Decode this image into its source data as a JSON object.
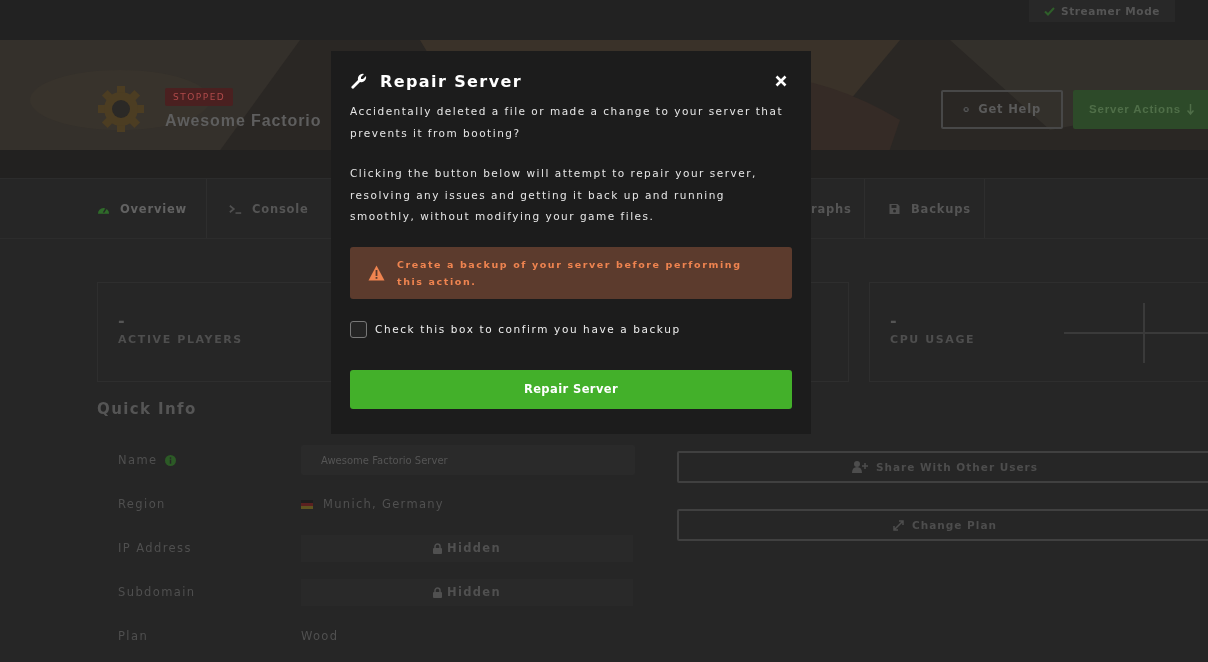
{
  "top_bar": {
    "streamer_mode": {
      "label": "Streamer Mode",
      "checked": true
    }
  },
  "header": {
    "status": "STOPPED",
    "server_name": "Awesome Factorio",
    "buttons": [
      {
        "label": "Get Help",
        "kind": "outline"
      },
      {
        "label": "Server Actions",
        "kind": "primary"
      }
    ]
  },
  "tabs": [
    {
      "label": "Overview",
      "selected": true,
      "kind": "gauge"
    },
    {
      "label": "Console",
      "selected": false,
      "kind": "terminal"
    },
    {
      "label": "raphs",
      "selected": false,
      "kind": "none"
    },
    {
      "label": "Backups",
      "selected": false,
      "kind": "disk"
    }
  ],
  "stats": [
    {
      "kind": "stat",
      "value": "-",
      "label": "ACTIVE PLAYERS"
    },
    {
      "kind": "covered"
    },
    {
      "kind": "stat",
      "value": "-",
      "label": "CPU USAGE"
    }
  ],
  "quick_info": {
    "title": "Quick Info",
    "rows": [
      {
        "label": "Name",
        "kind": "field",
        "value": "Awesome Factorio Server",
        "info": true
      },
      {
        "label": "Region",
        "kind": "flag",
        "value": "Munich, Germany"
      },
      {
        "label": "IP Address",
        "kind": "hidden",
        "value": "Hidden"
      },
      {
        "label": "Subdomain",
        "kind": "hidden",
        "value": "Hidden"
      },
      {
        "label": "Plan",
        "kind": "text",
        "value": "Wood"
      }
    ]
  },
  "side_actions": [
    {
      "label": "Share With Other Users",
      "kind": "share"
    },
    {
      "label": "Change Plan",
      "kind": "resize"
    }
  ],
  "modal": {
    "title": "Repair Server",
    "paragraphs": [
      "Accidentally deleted a file or made a change to your server that prevents it from booting?",
      "Clicking the button below will attempt to repair your server, resolving any issues and getting it back up and running smoothly, without modifying your game files."
    ],
    "warning": "Create a backup of your server before performing this action.",
    "confirm": {
      "label": "Check this box to confirm you have a backup",
      "checked": false
    },
    "button": "Repair Server"
  }
}
